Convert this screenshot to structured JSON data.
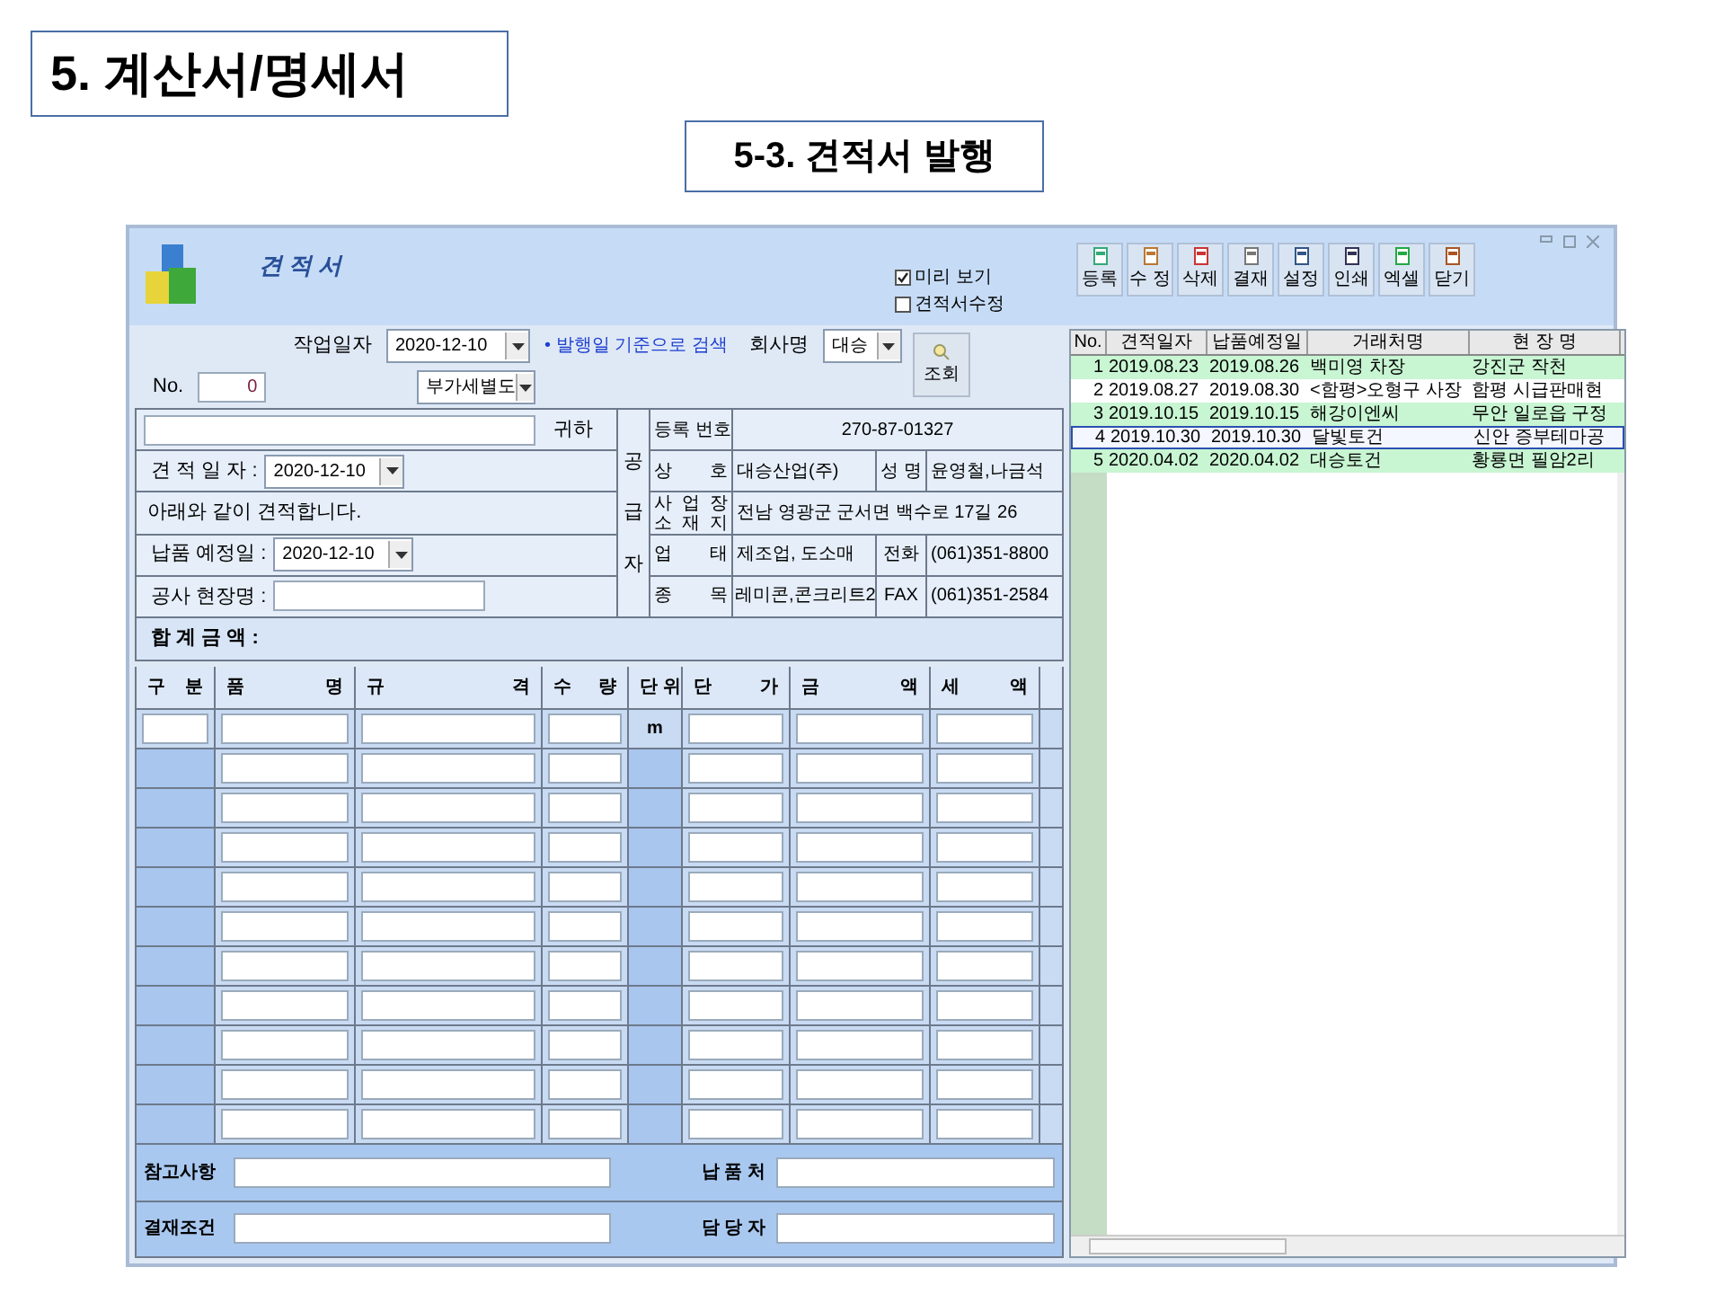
{
  "slide": {
    "title": "5. 계산서/명세서",
    "subtitle": "5-3. 견적서 발행"
  },
  "window": {
    "title": "견 적 서"
  },
  "options": [
    {
      "label": "미리 보기",
      "checked": true
    },
    {
      "label": "견적서수정",
      "checked": false
    }
  ],
  "toolbar": [
    "등록",
    "수 정",
    "삭제",
    "결재",
    "설정",
    "인쇄",
    "엑셀",
    "닫기"
  ],
  "search": {
    "date_label": "작업일자",
    "date": "2020-12-10",
    "hint": "• 발행일 기준으로 검색",
    "company_label": "회사명",
    "company": "대승",
    "button": "조회",
    "no_label": "No.",
    "no": "0",
    "tax": "부가세별도"
  },
  "estimate": {
    "recipient_suffix": "귀하",
    "date_label": "견 적 일 자 :",
    "date": "2020-12-10",
    "note": "아래와 같이 견적합니다.",
    "delivery_label": "납품 예정일 :",
    "delivery_date": "2020-12-10",
    "site_label": "공사 현장명 :"
  },
  "supplier": {
    "heading": "공급자",
    "reg_label": "등록 번호",
    "reg": "270-87-01327",
    "name_label": "상 호",
    "name": "대승산업(주)",
    "owner_label": "성 명",
    "owner": "윤영철,나금석",
    "addr_label": [
      "사 업 장",
      "소 재 지"
    ],
    "addr": "전남 영광군 군서면 백수로 17길 26",
    "type_label": "업 태",
    "type": "제조업, 도소매",
    "tel_label": "전화",
    "tel": "(061)351-8800",
    "item_label": "종 목",
    "item": "레미콘,콘크리트2",
    "fax_label": "FAX",
    "fax": "(061)351-2584"
  },
  "total_label": "합 계 금 액 :",
  "table": {
    "columns": [
      "구 분",
      "품 명",
      "규 격",
      "수 량",
      "단 위",
      "단 가",
      "금 액",
      "세 액"
    ],
    "rows": [
      {
        "kind": "full",
        "unit": "m"
      },
      {
        "kind": "partial"
      },
      {
        "kind": "partial"
      },
      {
        "kind": "partial"
      },
      {
        "kind": "partial"
      },
      {
        "kind": "partial"
      },
      {
        "kind": "partial"
      },
      {
        "kind": "partial"
      },
      {
        "kind": "partial"
      },
      {
        "kind": "partial"
      },
      {
        "kind": "partial"
      }
    ]
  },
  "footer": {
    "left": [
      "참고사항",
      "결재조건"
    ],
    "right": [
      "납 품 처",
      "담 당 자"
    ]
  },
  "list": {
    "columns": [
      "No.",
      "견적일자",
      "납품예정일",
      "거래처명",
      "현 장 명"
    ],
    "rows": [
      {
        "cells": [
          "1",
          "2019.08.23",
          "2019.08.26",
          "백미영 차장",
          "강진군 작천"
        ],
        "selected": false
      },
      {
        "cells": [
          "2",
          "2019.08.27",
          "2019.08.30",
          "<함평>오형구 사장",
          "함평 시급판매현"
        ],
        "selected": false
      },
      {
        "cells": [
          "3",
          "2019.10.15",
          "2019.10.15",
          "해강이엔씨",
          "무안 일로읍 구정"
        ],
        "selected": false
      },
      {
        "cells": [
          "4",
          "2019.10.30",
          "2019.10.30",
          "달빛토건",
          "신안 증부테마공"
        ],
        "selected": true
      },
      {
        "cells": [
          "5",
          "2020.04.02",
          "2020.04.02",
          "대승토건",
          "황룡면 필암2리"
        ],
        "selected": false
      }
    ]
  }
}
